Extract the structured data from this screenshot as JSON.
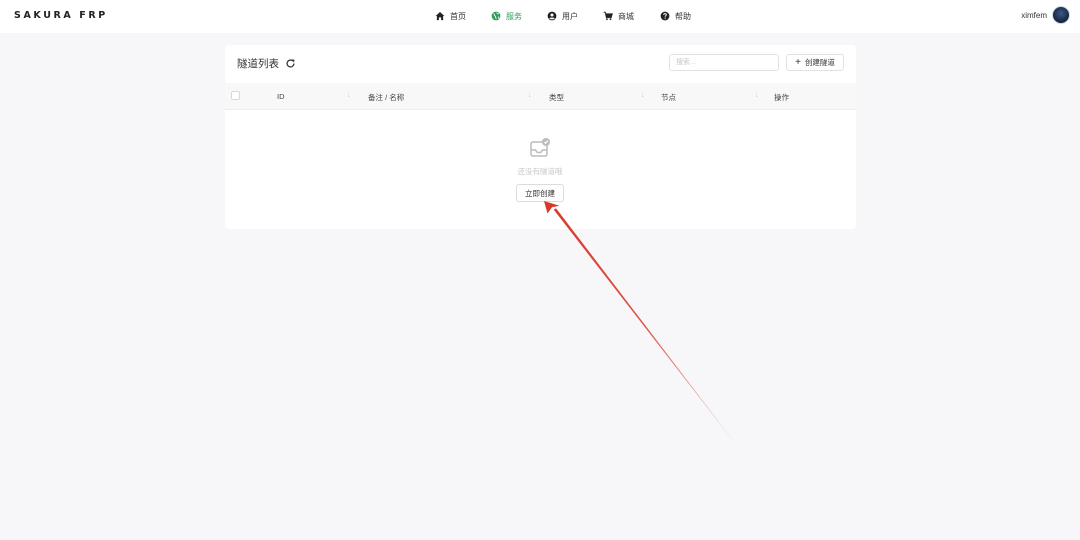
{
  "brand": "SAKURA FRP",
  "nav": [
    {
      "label": "首页",
      "icon": "home-icon"
    },
    {
      "label": "服务",
      "icon": "globe-icon",
      "active": true
    },
    {
      "label": "用户",
      "icon": "user-icon"
    },
    {
      "label": "商城",
      "icon": "cart-icon"
    },
    {
      "label": "帮助",
      "icon": "help-icon"
    }
  ],
  "user": {
    "name": "ximfem"
  },
  "card": {
    "title": "隧道列表",
    "search_placeholder": "搜索...",
    "create_button": "创建隧道",
    "columns": [
      "ID",
      "备注 / 名称",
      "类型",
      "节点",
      "操作"
    ],
    "empty_text": "还没有隧道哦",
    "create_now_button": "立即创建"
  },
  "colors": {
    "accent": "#2e9d5d",
    "background": "#f7f7f9",
    "annotation_arrow": "#d63a2b"
  }
}
